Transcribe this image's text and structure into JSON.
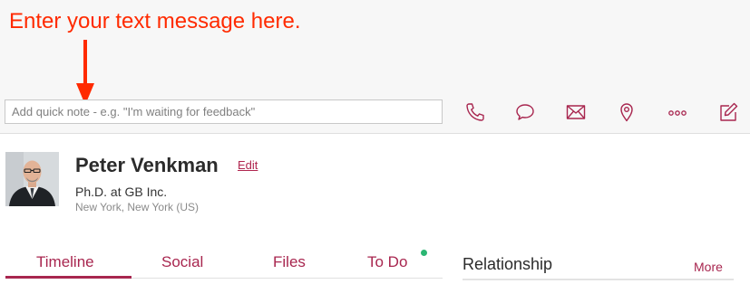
{
  "annotation": {
    "text": "Enter your text message here.",
    "color": "#ff2a00"
  },
  "quick_note": {
    "placeholder": "Add quick note - e.g. \"I'm waiting for feedback\""
  },
  "toolbar": {
    "icons": [
      "phone-icon",
      "chat-bubble-icon",
      "envelope-icon",
      "location-pin-icon",
      "more-dots-icon",
      "compose-icon"
    ],
    "accent": "#a8264f"
  },
  "contact": {
    "name": "Peter Venkman",
    "edit_label": "Edit",
    "title": "Ph.D. at GB Inc.",
    "location": "New York, New York (US)"
  },
  "tabs": {
    "items": [
      {
        "label": "Timeline",
        "active": true
      },
      {
        "label": "Social"
      },
      {
        "label": "Files"
      },
      {
        "label": "To Do",
        "indicator": "green-dot"
      }
    ],
    "indicator_color": "#2bb673"
  },
  "relationship": {
    "heading": "Relationship",
    "more_label": "More"
  }
}
